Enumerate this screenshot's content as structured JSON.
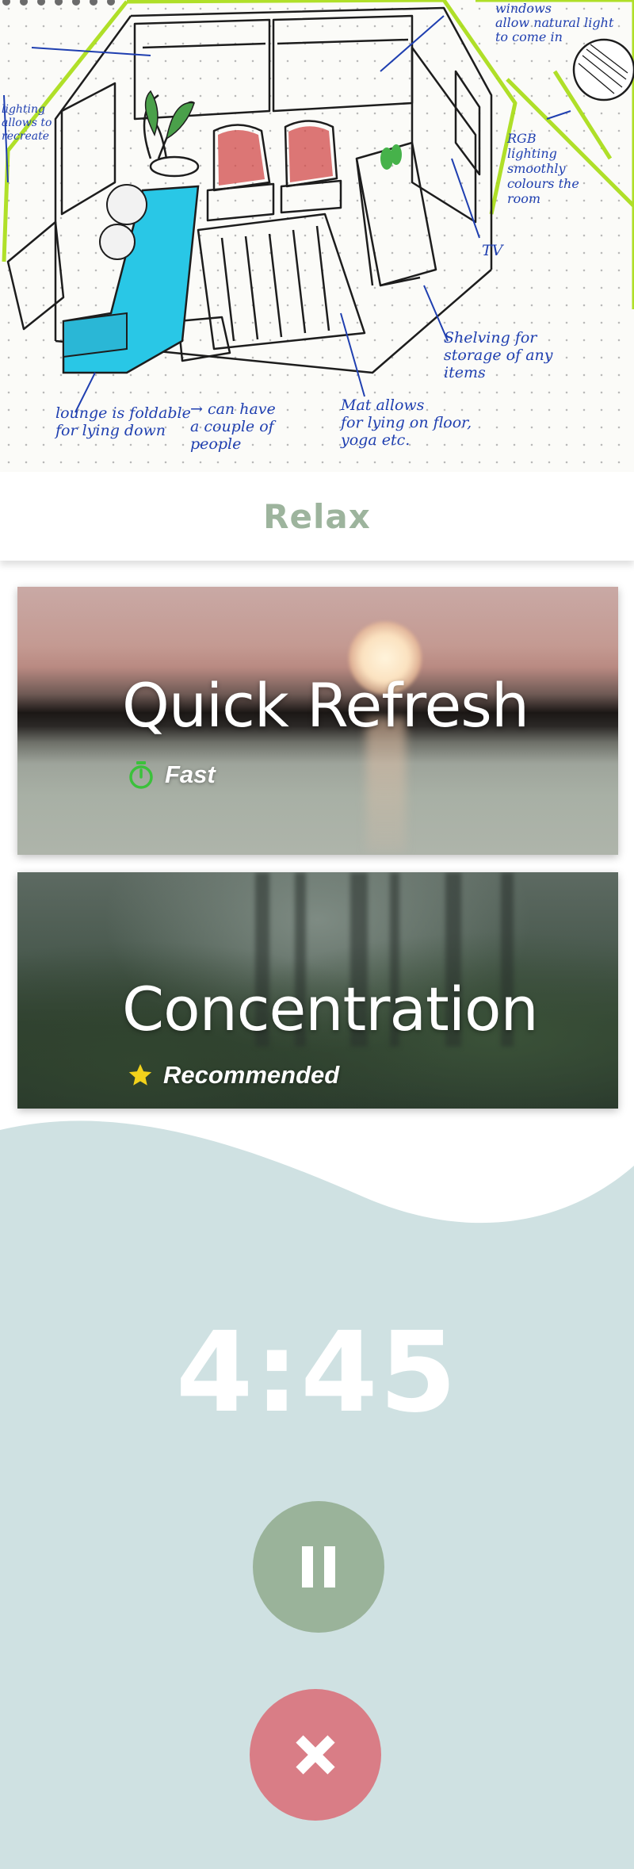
{
  "colors": {
    "relax_title": "#9db49d",
    "timer_panel": "#cfe1e2",
    "pause_button": "#9ab39a",
    "close_button": "#d97d86",
    "fast_icon": "#3bc13b",
    "star_icon": "#f2d21b",
    "sketch_ink": "#1f3fb0",
    "sketch_highlight": "#a7dd12",
    "sofa_fill": "#29c7e6",
    "chair_fill": "#d24a4a"
  },
  "sketch": {
    "notes": [
      "lounge is foldable\nfor lying down",
      "→ can have\na couple of\npeople",
      "Mat allows\nfor lying on floor,\nyoga etc.",
      "Shelving for\nstorage of any\nitems",
      "RGB\nlighting\nsmoothly\ncolours the\nroom",
      "TV",
      "windows\nallow natural light\nto come in",
      "lighting\nallows to\nrecreate"
    ]
  },
  "header": {
    "title": "Relax"
  },
  "cards": [
    {
      "title": "Quick Refresh",
      "tag": "Fast",
      "icon": "stopwatch-icon"
    },
    {
      "title": "Concentration",
      "tag": "Recommended",
      "icon": "star-icon"
    }
  ],
  "timer": {
    "value": "4:45"
  },
  "controls": {
    "pause_icon": "pause-icon",
    "close_icon": "close-icon"
  }
}
